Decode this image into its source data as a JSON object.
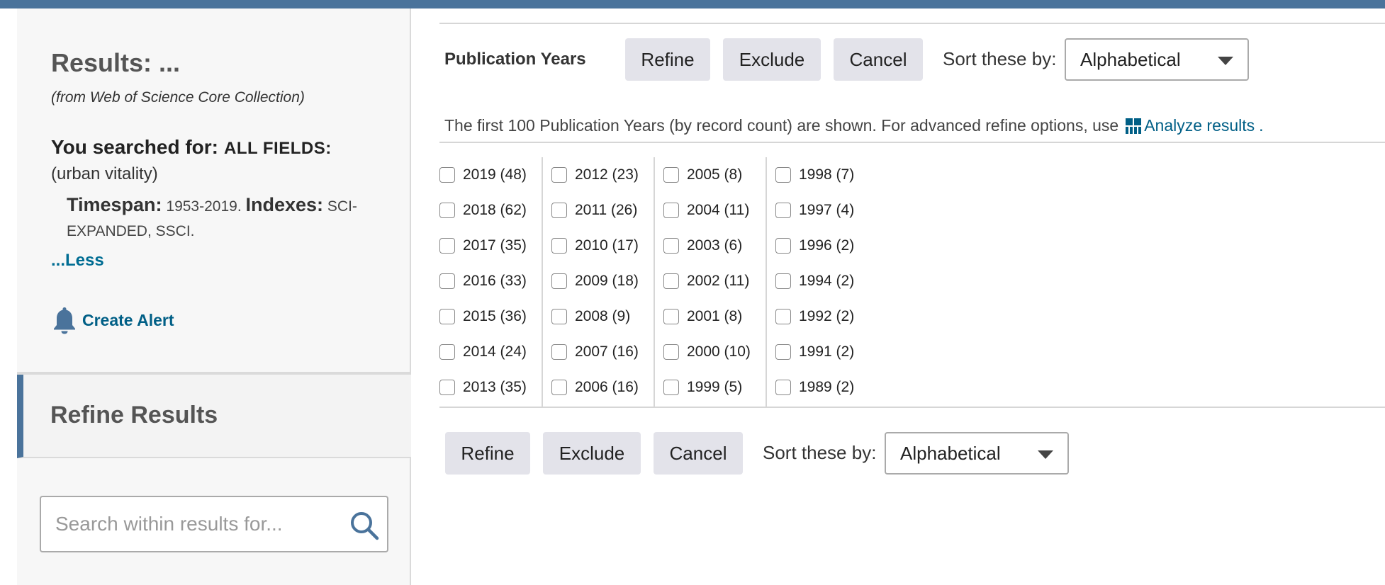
{
  "sidebar": {
    "results_title": "Results: ...",
    "results_source": "(from Web of Science Core Collection)",
    "searched_label": "You searched for:",
    "searched_fields": "ALL FIELDS:",
    "query": "(urban vitality)",
    "timespan_label": "Timespan:",
    "timespan_value": "1953-2019.",
    "indexes_label": "Indexes:",
    "indexes_value": "SCI-EXPANDED, SSCI.",
    "less_link": "...Less",
    "create_alert": "Create Alert",
    "refine_results": "Refine Results",
    "search_placeholder": "Search within results for..."
  },
  "facet": {
    "title": "Publication Years",
    "buttons": {
      "refine": "Refine",
      "exclude": "Exclude",
      "cancel": "Cancel"
    },
    "sort_label": "Sort these by:",
    "sort_value": "Alphabetical",
    "info_text": "The first 100 Publication Years (by record count) are shown. For advanced refine options, use",
    "analyze_link": "Analyze results",
    "info_suffix": ".",
    "years": [
      [
        "2019 (48)",
        "2018 (62)",
        "2017 (35)",
        "2016 (33)",
        "2015 (36)",
        "2014 (24)",
        "2013 (35)"
      ],
      [
        "2012 (23)",
        "2011 (26)",
        "2010 (17)",
        "2009 (18)",
        "2008 (9)",
        "2007 (16)",
        "2006 (16)"
      ],
      [
        "2005 (8)",
        "2004 (11)",
        "2003 (6)",
        "2002 (11)",
        "2001 (8)",
        "2000 (10)",
        "1999 (5)"
      ],
      [
        "1998 (7)",
        "1997 (4)",
        "1996 (2)",
        "1994 (2)",
        "1992 (2)",
        "1991 (2)",
        "1989 (2)"
      ]
    ]
  },
  "colors": {
    "accent": "#4a739b",
    "link": "#005f86",
    "button_bg": "#e3e3ea"
  }
}
